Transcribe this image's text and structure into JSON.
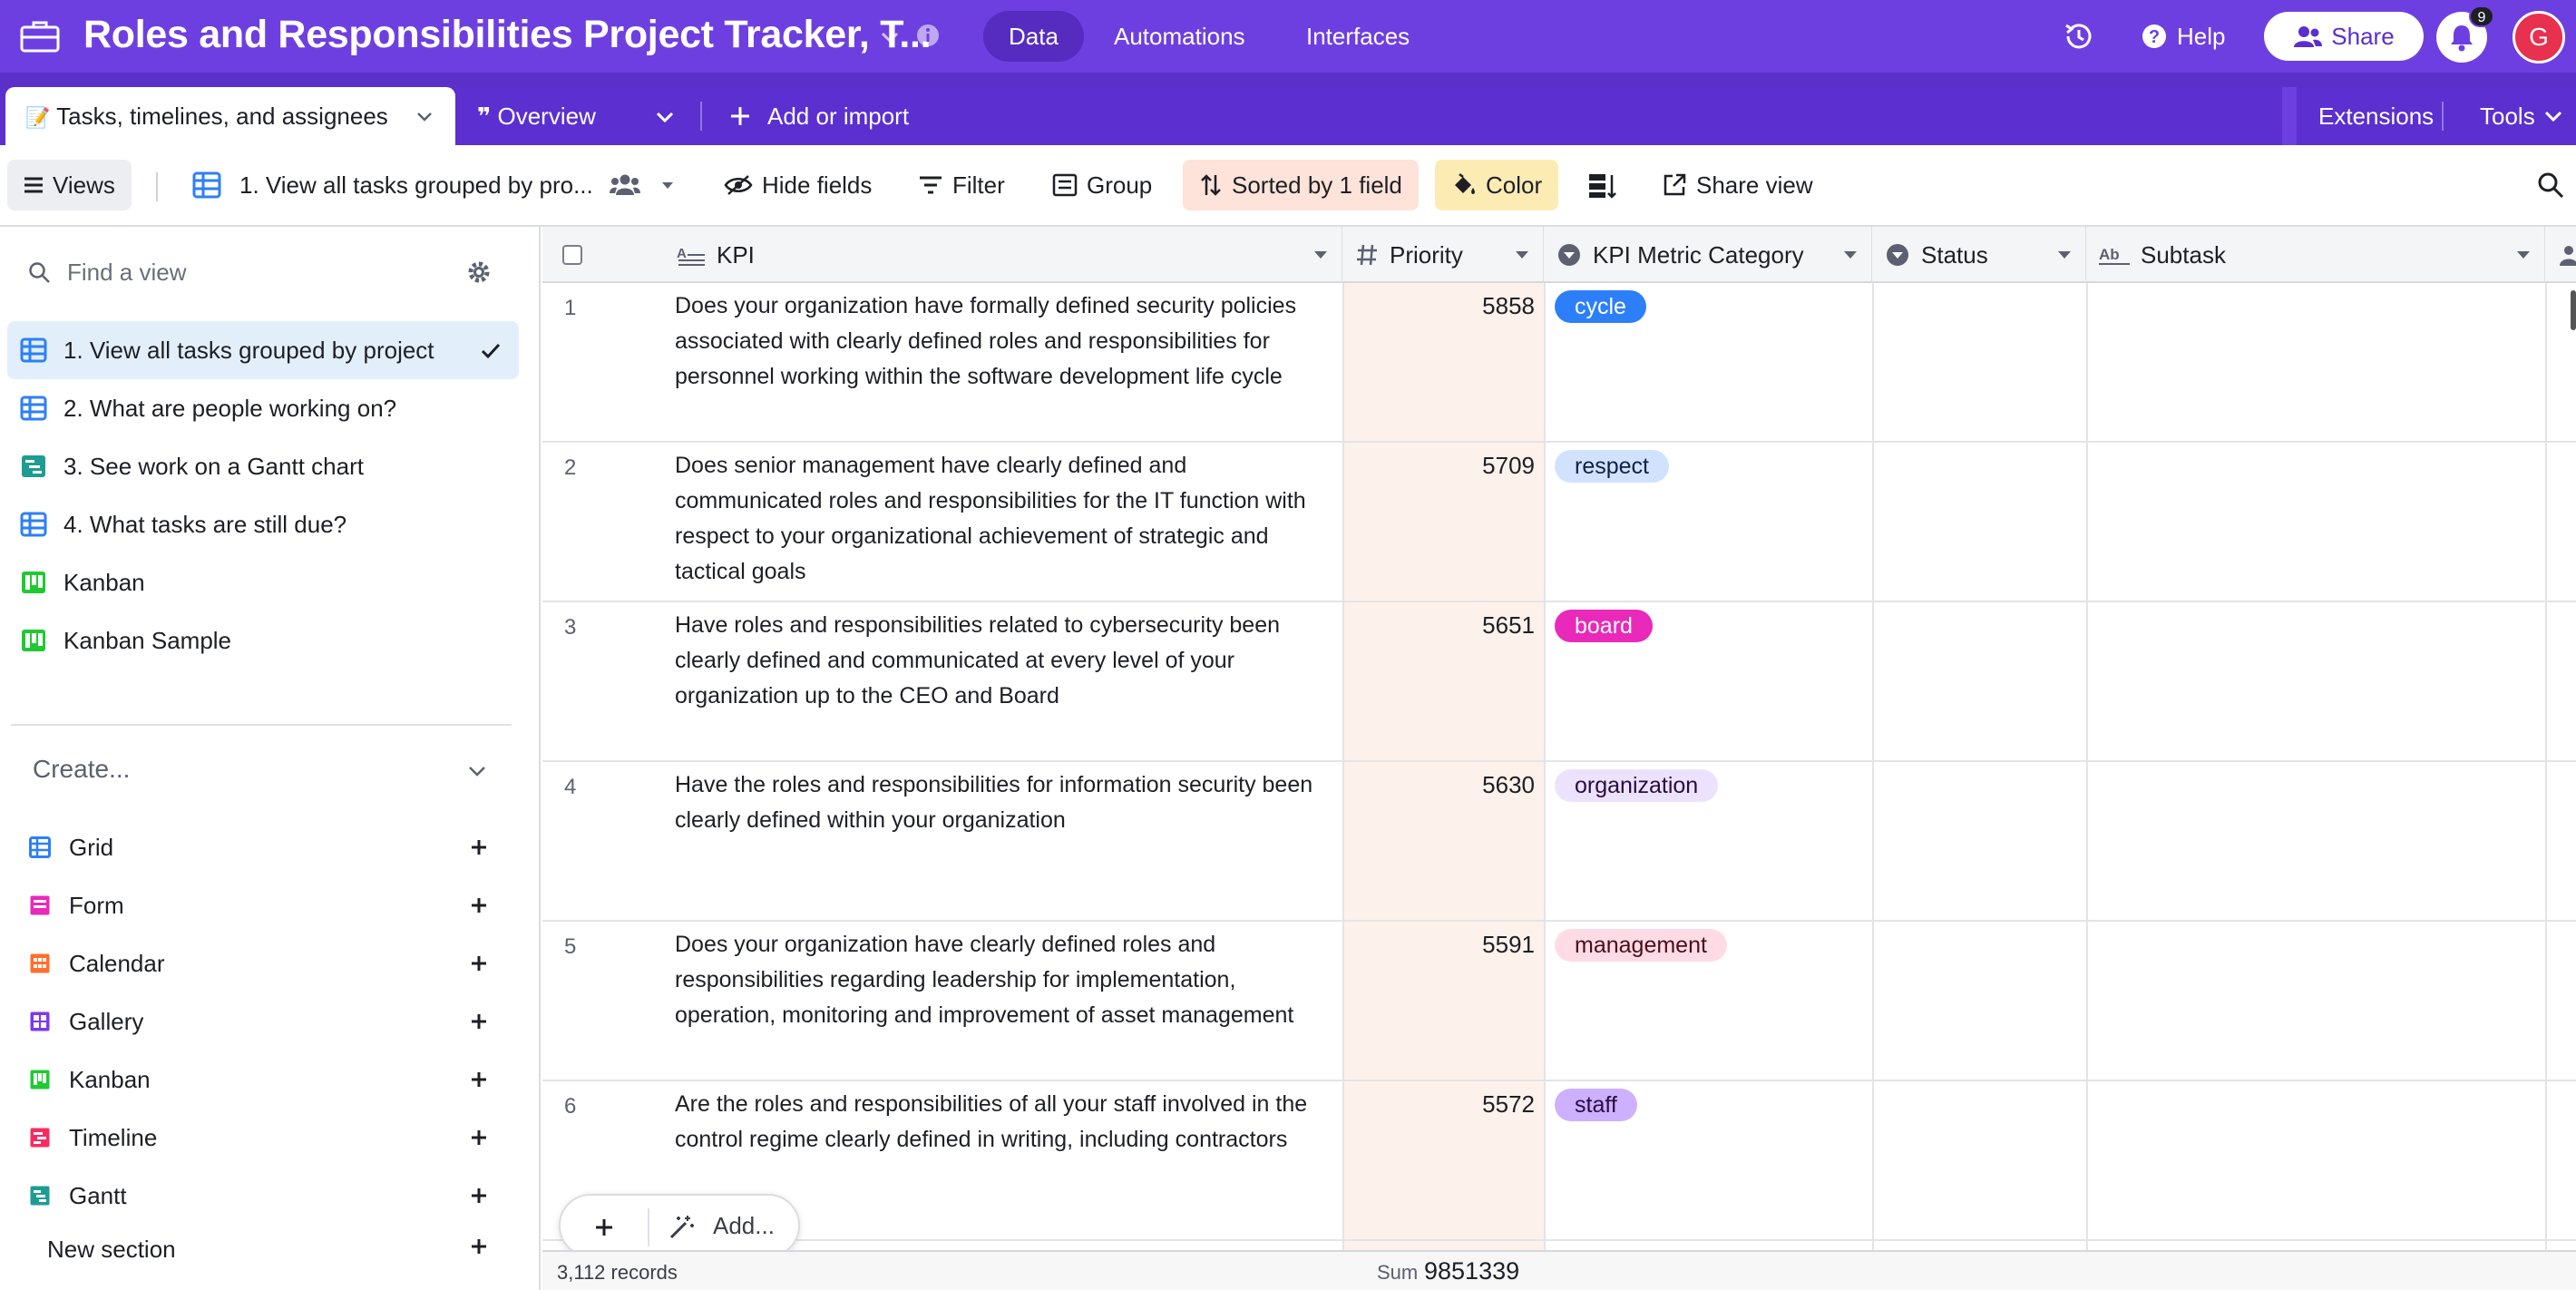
{
  "app": {
    "title": "Roles and Responsibilities Project Tracker, T...",
    "nav": [
      "Data",
      "Automations",
      "Interfaces"
    ],
    "help_label": "Help",
    "share_label": "Share",
    "notification_count": "9",
    "avatar_initial": "G",
    "accent_color": "#6e3fe0"
  },
  "tabs": {
    "active_label": "Tasks, timelines, and assignees",
    "overview_label": "Overview",
    "add_label": "Add or import",
    "extensions_label": "Extensions",
    "tools_label": "Tools"
  },
  "viewbar": {
    "views_label": "Views",
    "current_view": "1. View all tasks grouped by pro...",
    "hide_fields": "Hide fields",
    "filter": "Filter",
    "group": "Group",
    "sorted": "Sorted by 1 field",
    "color": "Color",
    "share_view": "Share view"
  },
  "sidebar": {
    "find_placeholder": "Find a view",
    "views": [
      {
        "label": "1. View all tasks grouped by project",
        "icon": "grid-view-icon",
        "active": true
      },
      {
        "label": "2. What are people working on?",
        "icon": "grid-view-icon",
        "active": false
      },
      {
        "label": "3. See work on a Gantt chart",
        "icon": "gantt-view-icon",
        "active": false
      },
      {
        "label": "4. What tasks are still due?",
        "icon": "grid-view-icon",
        "active": false
      },
      {
        "label": "Kanban",
        "icon": "kanban-view-icon",
        "active": false
      },
      {
        "label": "Kanban Sample",
        "icon": "kanban-view-icon",
        "active": false
      }
    ],
    "create_label": "Create...",
    "create_items": [
      {
        "label": "Grid",
        "icon": "grid-icon",
        "color": "#2d7ff9"
      },
      {
        "label": "Form",
        "icon": "form-icon",
        "color": "#e929ba"
      },
      {
        "label": "Calendar",
        "icon": "calendar-icon",
        "color": "#ff6f2c"
      },
      {
        "label": "Gallery",
        "icon": "gallery-icon",
        "color": "#7c39ed"
      },
      {
        "label": "Kanban",
        "icon": "kanban-icon",
        "color": "#20c933"
      },
      {
        "label": "Timeline",
        "icon": "timeline-icon",
        "color": "#f82b60"
      },
      {
        "label": "Gantt",
        "icon": "gantt-icon",
        "color": "#1e9c93"
      }
    ],
    "new_section_label": "New section"
  },
  "grid": {
    "columns": [
      "KPI",
      "Priority",
      "KPI Metric Category",
      "Status",
      "Subtask"
    ],
    "rows": [
      {
        "num": "1",
        "kpi": "Does your organization have formally defined security policies associated with clearly defined roles and responsibilities for personnel working within the software development life cycle",
        "priority": "5858",
        "category": "cycle",
        "cat_bg": "#2d7ff9",
        "cat_fg": "#ffffff"
      },
      {
        "num": "2",
        "kpi": "Does senior management have clearly defined and communicated roles and responsibilities for the IT function with respect to your organizational achievement of strategic and tactical goals",
        "priority": "5709",
        "category": "respect",
        "cat_bg": "#d1e2ff",
        "cat_fg": "#102046"
      },
      {
        "num": "3",
        "kpi": "Have roles and responsibilities related to cybersecurity been clearly defined and communicated at every level of your organization up to the CEO and Board",
        "priority": "5651",
        "category": "board",
        "cat_bg": "#e929ba",
        "cat_fg": "#ffffff"
      },
      {
        "num": "4",
        "kpi": "Have the roles and responsibilities for information security been clearly defined within your organization",
        "priority": "5630",
        "category": "organization",
        "cat_bg": "#ede2fe",
        "cat_fg": "#280b42"
      },
      {
        "num": "5",
        "kpi": "Does your organization have clearly defined roles and responsibilities regarding leadership for implementation, operation, monitoring and improvement of asset management",
        "priority": "5591",
        "category": "management",
        "cat_bg": "#ffdce5",
        "cat_fg": "#4c0c1c"
      },
      {
        "num": "6",
        "kpi": "Are the roles and responsibilities of all your staff involved in the control regime clearly defined in writing, including contractors",
        "priority": "5572",
        "category": "staff",
        "cat_bg": "#cdb0ff",
        "cat_fg": "#280b42"
      }
    ],
    "records_count": "3,112 records",
    "sum_label": "Sum",
    "sum_value": "9851339",
    "add_label": "Add..."
  }
}
